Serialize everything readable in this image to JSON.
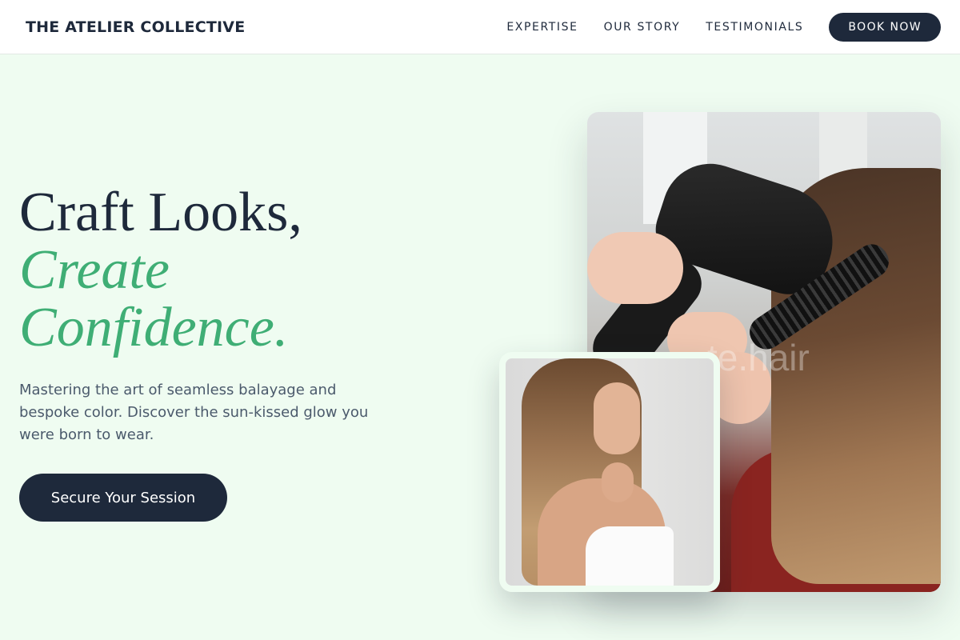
{
  "header": {
    "brand": "THE ATELIER COLLECTIVE",
    "nav": [
      "EXPERTISE",
      "OUR STORY",
      "TESTIMONIALS"
    ],
    "cta_label": "BOOK NOW"
  },
  "hero": {
    "headline_line1": "Craft Looks,",
    "headline_line2": "Create",
    "headline_line3": "Confidence.",
    "intro": "Mastering the art of seamless balayage and bespoke color. Discover the sun-kissed glow you were born to wear.",
    "cta_label": "Secure Your Session"
  },
  "images": {
    "main_watermark": "te.hair"
  },
  "colors": {
    "accent": "#3fae75",
    "dark": "#1e293b",
    "background": "#effcf1"
  }
}
